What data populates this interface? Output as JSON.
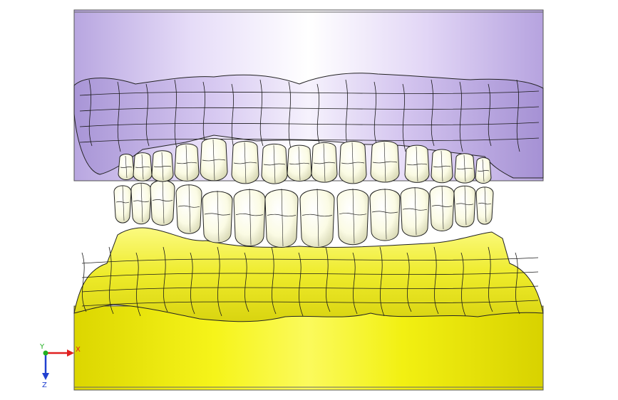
{
  "viewport": {
    "background": "#ffffff"
  },
  "model": {
    "upper_base_color": "#d4c3ef",
    "upper_gum_color": "#c8b6e6",
    "tooth_color": "#fafadc",
    "lower_gum_color": "#f0ef2a",
    "lower_base_color": "#f4f20c",
    "mesh_line_color": "#1a1a1a"
  },
  "triad": {
    "x_label": "X",
    "y_label": "Y",
    "z_label": "Z",
    "x_color": "#e02020",
    "y_color": "#20b020",
    "z_color": "#2040d0"
  }
}
